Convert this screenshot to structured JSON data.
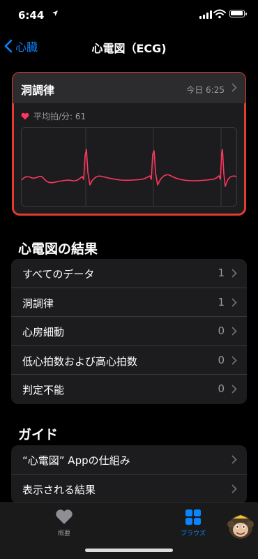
{
  "status_bar": {
    "time": "6:44",
    "location_icon": "location-arrow-icon"
  },
  "nav": {
    "back_label": "心臓",
    "title": "心電図（ECG)"
  },
  "ecg_card": {
    "title": "洞調律",
    "date": "今日 6:25",
    "bpm_label": "平均拍/分: 61",
    "accent_color": "#e53a2f",
    "trace_color": "#ff375f"
  },
  "results": {
    "heading": "心電図の結果",
    "rows": [
      {
        "label": "すべてのデータ",
        "value": "1"
      },
      {
        "label": "洞調律",
        "value": "1"
      },
      {
        "label": "心房細動",
        "value": "0"
      },
      {
        "label": "低心拍数および高心拍数",
        "value": "0"
      },
      {
        "label": "判定不能",
        "value": "0"
      }
    ]
  },
  "guide": {
    "heading": "ガイド",
    "rows": [
      {
        "label": "“心電図” Appの仕組み"
      },
      {
        "label": "表示される結果"
      }
    ]
  },
  "tabbar": {
    "summary_label": "概要",
    "browse_label": "ブラウズ",
    "active_color": "#0a84ff"
  }
}
